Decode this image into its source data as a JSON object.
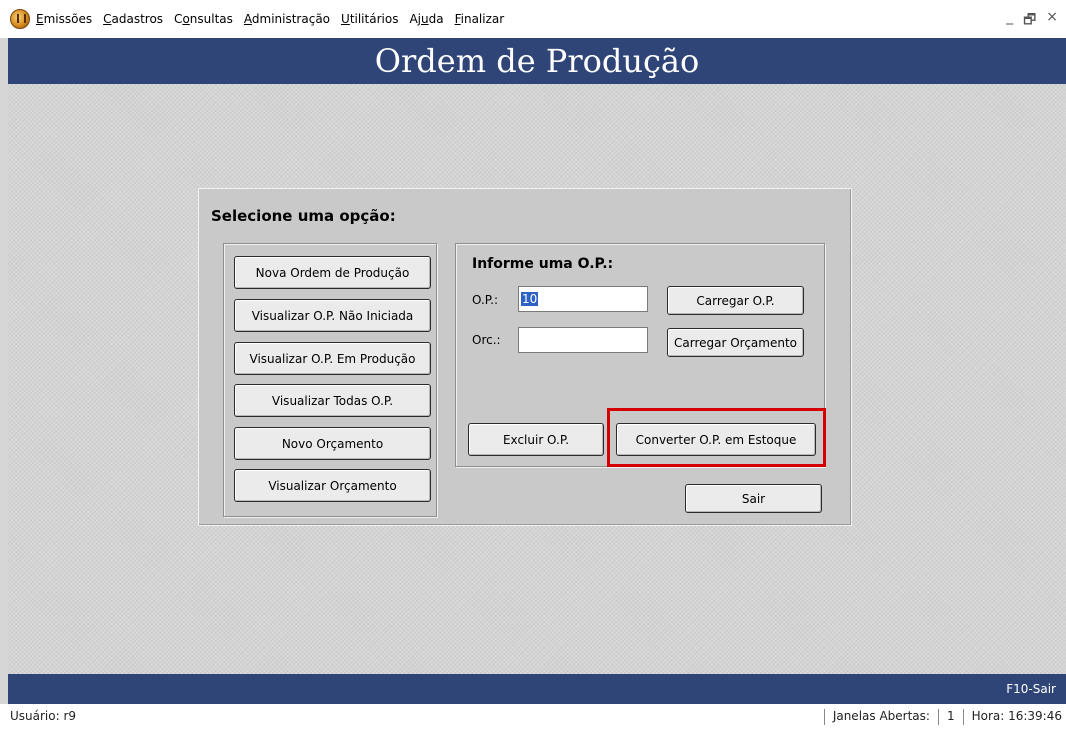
{
  "menu": {
    "items": [
      {
        "acc": "E",
        "rest": "missões"
      },
      {
        "acc": "C",
        "rest": "adastros"
      },
      {
        "pre": "C",
        "acc": "o",
        "rest": "nsultas"
      },
      {
        "acc": "A",
        "rest": "dministração"
      },
      {
        "acc": "U",
        "rest": "tilitários"
      },
      {
        "pre": "Aj",
        "acc": "u",
        "rest": "da"
      },
      {
        "acc": "F",
        "rest": "inalizar"
      }
    ],
    "window_controls": [
      "_",
      "🗗",
      "×"
    ]
  },
  "title": "Ordem de Produção",
  "panel": {
    "title": "Selecione uma opção:",
    "left_buttons": [
      "Nova Ordem de Produção",
      "Visualizar O.P. Não Iniciada",
      "Visualizar O.P. Em Produção",
      "Visualizar Todas O.P.",
      "Novo Orçamento",
      "Visualizar Orçamento"
    ],
    "right": {
      "title": "Informe uma O.P.:",
      "op_label": "O.P.:",
      "op_value": "10",
      "orc_label": "Orc.:",
      "orc_value": "",
      "load_op": "Carregar O.P.",
      "load_orc": "Carregar Orçamento",
      "delete_op": "Excluir O.P.",
      "convert_op": "Converter O.P. em Estoque"
    },
    "exit": "Sair"
  },
  "bottombar": {
    "shortcut": "F10-Sair"
  },
  "status": {
    "user": "Usuário: r9",
    "windows_label": "Janelas Abertas:",
    "windows_count": "1",
    "time": "Hora: 16:39:46"
  },
  "colors": {
    "navy": "#2f4477",
    "highlight": "#d40000"
  }
}
